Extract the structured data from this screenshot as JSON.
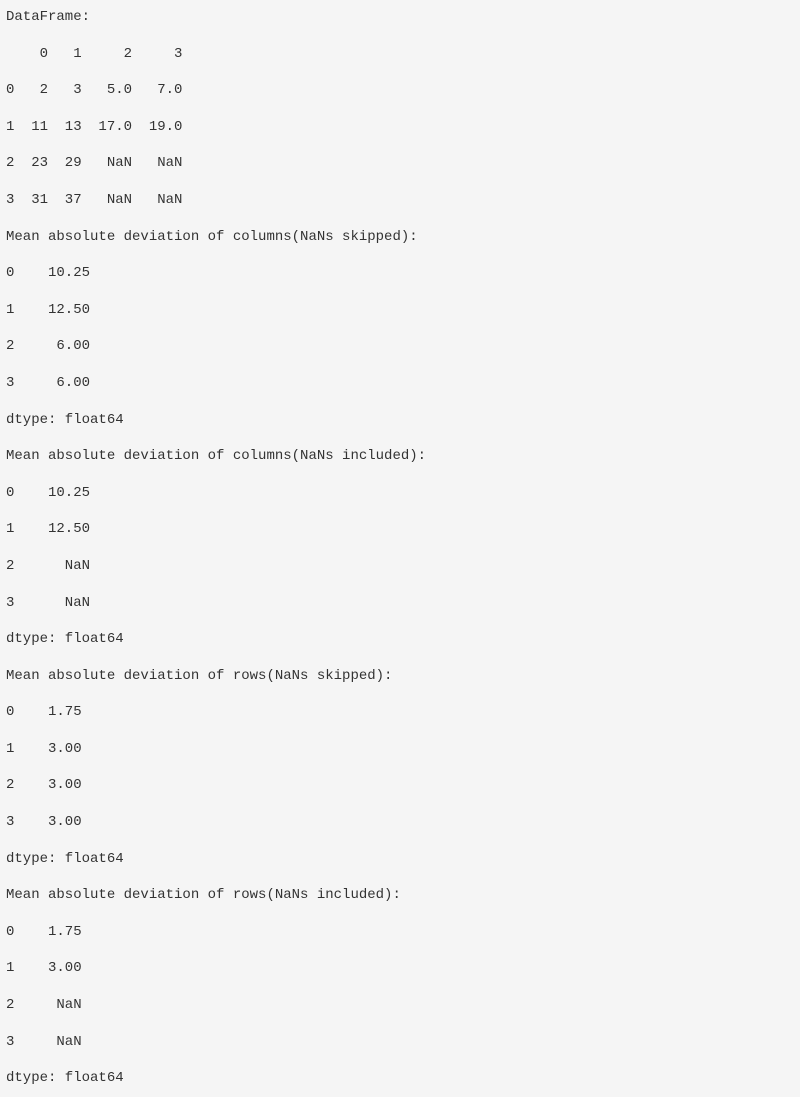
{
  "lines": [
    "DataFrame:",
    "    0   1     2     3",
    "0   2   3   5.0   7.0",
    "1  11  13  17.0  19.0",
    "2  23  29   NaN   NaN",
    "3  31  37   NaN   NaN",
    "Mean absolute deviation of columns(NaNs skipped):",
    "0    10.25",
    "1    12.50",
    "2     6.00",
    "3     6.00",
    "dtype: float64",
    "Mean absolute deviation of columns(NaNs included):",
    "0    10.25",
    "1    12.50",
    "2      NaN",
    "3      NaN",
    "dtype: float64",
    "Mean absolute deviation of rows(NaNs skipped):",
    "0    1.75",
    "1    3.00",
    "2    3.00",
    "3    3.00",
    "dtype: float64",
    "Mean absolute deviation of rows(NaNs included):",
    "0    1.75",
    "1    3.00",
    "2     NaN",
    "3     NaN",
    "dtype: float64"
  ]
}
